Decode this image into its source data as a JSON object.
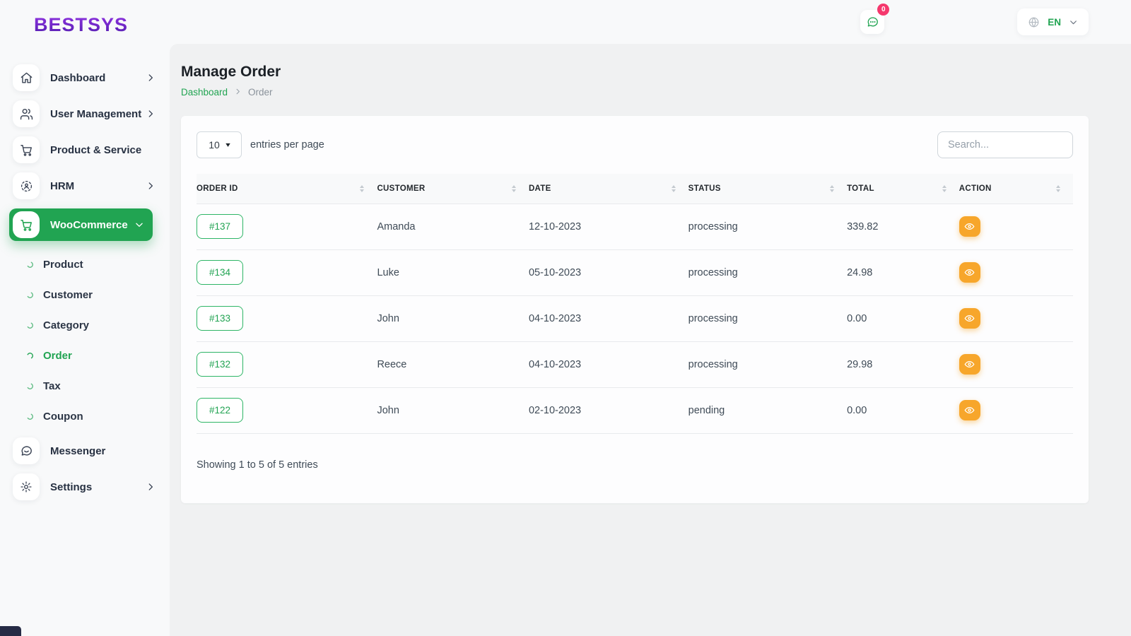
{
  "brand": {
    "logo_text": "BESTSYS"
  },
  "topbar": {
    "chat_badge_count": "0",
    "language_code": "EN"
  },
  "sidebar": {
    "items": [
      {
        "label": "Dashboard"
      },
      {
        "label": "User Management"
      },
      {
        "label": "Product & Service"
      },
      {
        "label": "HRM"
      },
      {
        "label": "WooCommerce"
      }
    ],
    "submenu": [
      {
        "label": "Product"
      },
      {
        "label": "Customer"
      },
      {
        "label": "Category"
      },
      {
        "label": "Order"
      },
      {
        "label": "Tax"
      },
      {
        "label": "Coupon"
      }
    ],
    "bottom_items": [
      {
        "label": "Messenger"
      },
      {
        "label": "Settings"
      }
    ]
  },
  "page": {
    "title": "Manage Order",
    "breadcrumb": {
      "parent": "Dashboard",
      "current": "Order"
    }
  },
  "controls": {
    "page_size": "10",
    "entries_label": "entries per page",
    "search_placeholder": "Search..."
  },
  "table": {
    "columns": [
      "Order Id",
      "Customer",
      "Date",
      "Status",
      "Total",
      "Action"
    ],
    "rows": [
      {
        "order_id": "#137",
        "customer": "Amanda",
        "date": "12-10-2023",
        "status": "processing",
        "total": "339.82"
      },
      {
        "order_id": "#134",
        "customer": "Luke",
        "date": "05-10-2023",
        "status": "processing",
        "total": "24.98"
      },
      {
        "order_id": "#133",
        "customer": "John",
        "date": "04-10-2023",
        "status": "processing",
        "total": "0.00"
      },
      {
        "order_id": "#132",
        "customer": "Reece",
        "date": "04-10-2023",
        "status": "processing",
        "total": "29.98"
      },
      {
        "order_id": "#122",
        "customer": "John",
        "date": "02-10-2023",
        "status": "pending",
        "total": "0.00"
      }
    ],
    "summary": "Showing 1 to 5 of 5 entries"
  },
  "colors": {
    "accent_green": "#21a452",
    "action_orange": "#f7a62b",
    "badge_pink": "#f5386d",
    "logo_purple": "#6d28d9"
  }
}
